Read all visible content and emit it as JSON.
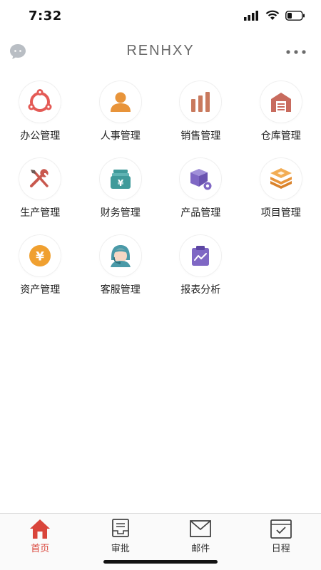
{
  "status_bar": {
    "time": "7:32"
  },
  "nav": {
    "title": "RENHXY",
    "left_icon": "chat-bubble-icon",
    "right_icon": "more-icon"
  },
  "modules": [
    {
      "label": "办公管理",
      "icon": "office-icon",
      "color": "#e45a55"
    },
    {
      "label": "人事管理",
      "icon": "person-icon",
      "color": "#e8943a"
    },
    {
      "label": "销售管理",
      "icon": "bar-chart-icon",
      "color": "#c97a5e"
    },
    {
      "label": "仓库管理",
      "icon": "warehouse-icon",
      "color": "#c86b5e"
    },
    {
      "label": "生产管理",
      "icon": "tools-icon",
      "color": "#c8584e"
    },
    {
      "label": "财务管理",
      "icon": "finance-icon",
      "color": "#3f9a9a"
    },
    {
      "label": "产品管理",
      "icon": "product-box-icon",
      "color": "#7f67c4"
    },
    {
      "label": "项目管理",
      "icon": "layers-icon",
      "color": "#e8943a"
    },
    {
      "label": "资产管理",
      "icon": "yen-coin-icon",
      "color": "#f0a030"
    },
    {
      "label": "客服管理",
      "icon": "customer-service-icon",
      "color": "#4a9aa8"
    },
    {
      "label": "报表分析",
      "icon": "report-icon",
      "color": "#7f67c4"
    }
  ],
  "tabs": [
    {
      "label": "首页",
      "icon": "home-icon",
      "active": true
    },
    {
      "label": "审批",
      "icon": "approval-icon",
      "active": false
    },
    {
      "label": "邮件",
      "icon": "mail-icon",
      "active": false
    },
    {
      "label": "日程",
      "icon": "calendar-icon",
      "active": false
    }
  ],
  "colors": {
    "accent": "#d9453b",
    "tab_inactive": "#333333"
  }
}
